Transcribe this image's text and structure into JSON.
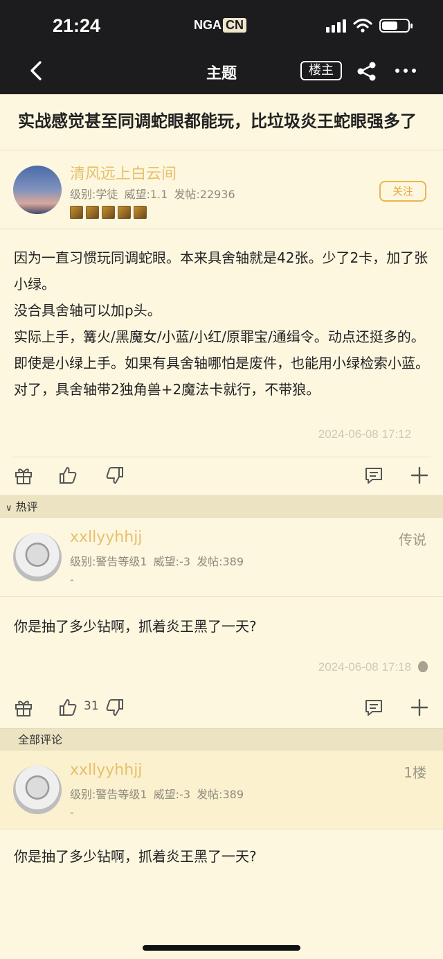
{
  "status_bar": {
    "time": "21:24",
    "logo_text": "NGA",
    "logo_suffix": "CN",
    "battery_level": 0.6
  },
  "nav": {
    "title": "主题",
    "owner_button": "楼主"
  },
  "topic": {
    "title": "实战感觉甚至同调蛇眼都能玩，比垃圾炎王蛇眼强多了"
  },
  "main_post": {
    "author": "清风远上白云间",
    "meta": "级别:学徒 威望:1.1 发帖:22936",
    "follow_label": "关注",
    "paragraphs": [
      "因为一直习惯玩同调蛇眼。本来具舍轴就是42张。少了2卡，加了张小绿。",
      "没合具舍轴可以加p头。",
      "实际上手，篝火/黑魔女/小蓝/小红/原罪宝/通缉令。动点还挺多的。",
      "即使是小绿上手。如果有具舍轴哪怕是废件，也能用小绿检索小蓝。",
      "对了，具舍轴带2独角兽+2魔法卡就行，不带狼。"
    ],
    "time": "2024-06-08 17:12"
  },
  "hot_section": {
    "label": "热评"
  },
  "hot_comment": {
    "author": "xxllyyhhjj",
    "meta": "级别:警告等级1 威望:-3 发帖:389",
    "extra": "-",
    "tag": "传说",
    "content": "你是抽了多少钻啊，抓着炎王黑了一天?",
    "time": "2024-06-08 17:18",
    "likes": "31"
  },
  "all_section": {
    "label": "全部评论"
  },
  "floor1": {
    "author": "xxllyyhhjj",
    "meta": "级别:警告等级1 威望:-3 发帖:389",
    "extra": "-",
    "floor": "1楼",
    "content": "你是抽了多少钻啊，抓着炎王黑了一天?"
  }
}
